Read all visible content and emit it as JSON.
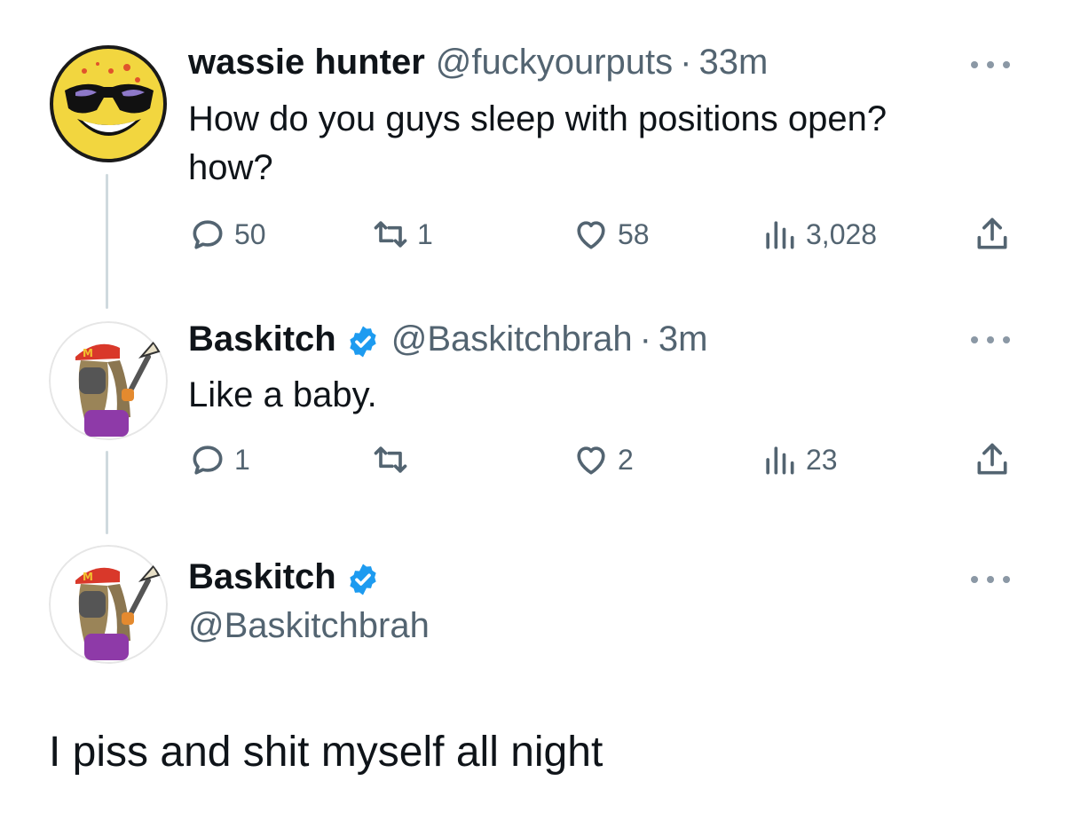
{
  "tweets": [
    {
      "name": "wassie hunter",
      "handle": "@fuckyourputs",
      "separator": "·",
      "time": "33m",
      "text_line1": "How do you guys sleep with positions open?",
      "text_line2": "how?",
      "replies": "50",
      "retweets": "1",
      "likes": "58",
      "views": "3,028"
    },
    {
      "name": "Baskitch",
      "handle": "@Baskitchbrah",
      "separator": "·",
      "time": "3m",
      "text": "Like a baby.",
      "replies": "1",
      "retweets": "",
      "likes": "2",
      "views": "23"
    }
  ],
  "composer": {
    "name": "Baskitch",
    "handle": "@Baskitchbrah",
    "text": "I piss and shit myself all night"
  },
  "colors": {
    "text": "#0f1419",
    "muted": "#536471",
    "verified": "#1d9bf0",
    "thread_line": "#cfd9de"
  }
}
